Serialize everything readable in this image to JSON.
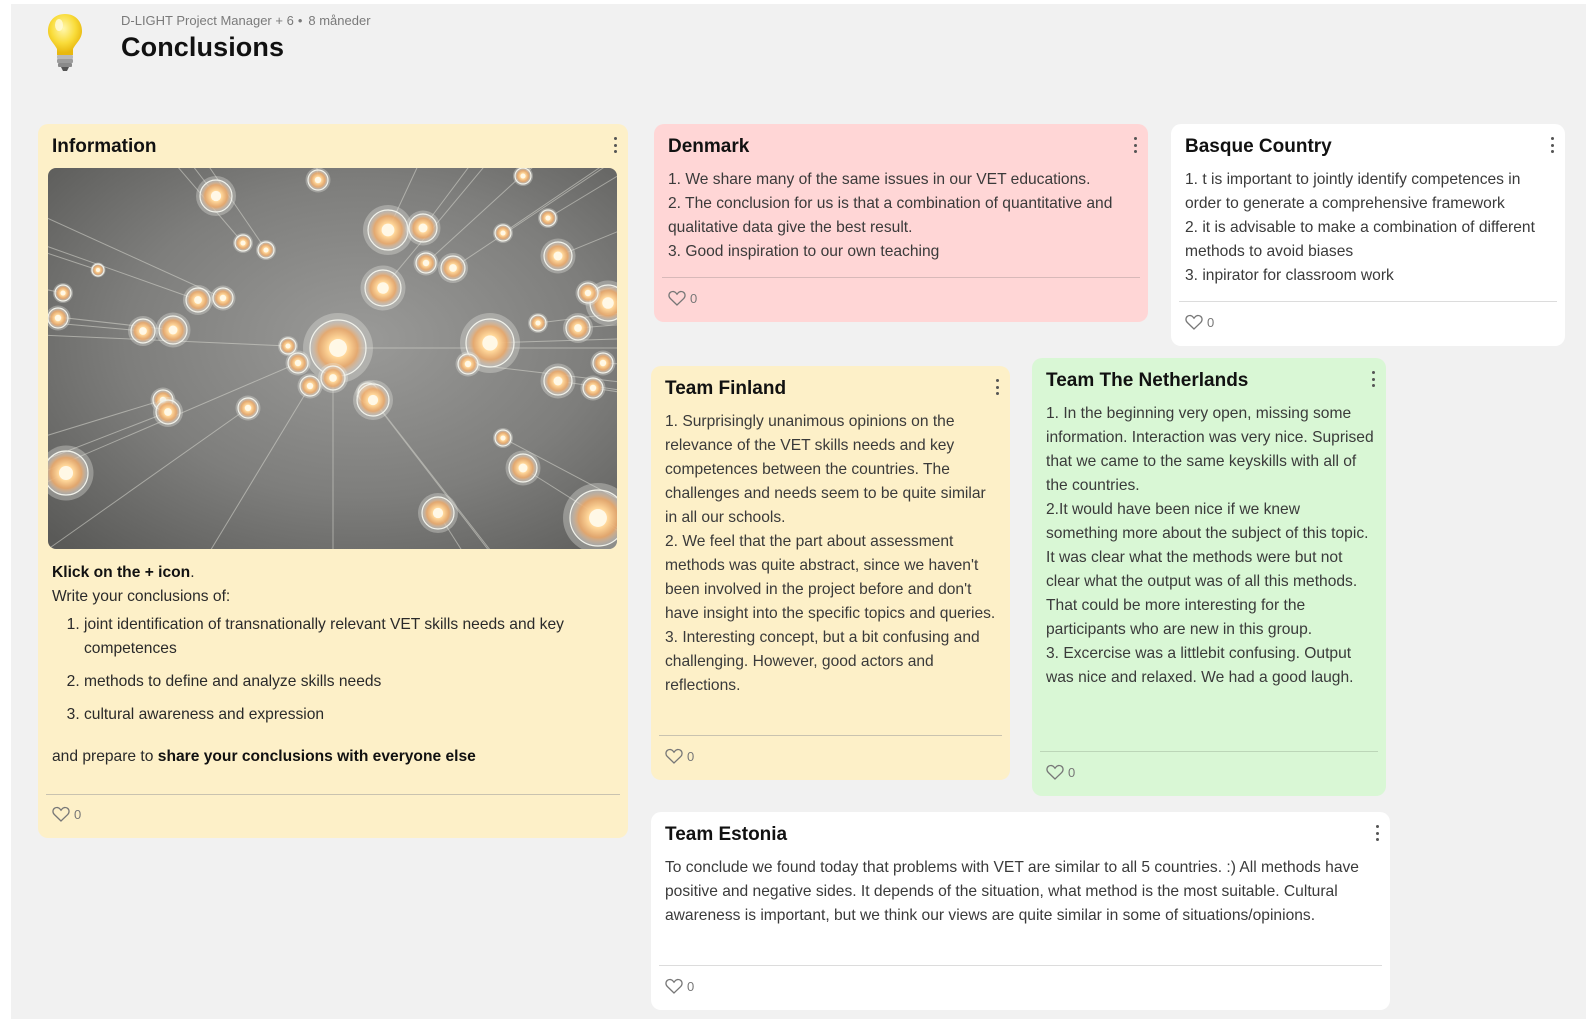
{
  "header": {
    "meta_author": "D-LIGHT Project Manager + 6",
    "meta_time": "8 måneder",
    "title": "Conclusions"
  },
  "colors": {
    "yellow_card": "#fdf0c8",
    "pink_card": "#ffd6d6",
    "green_card": "#d9f7d5",
    "white_card": "#ffffff",
    "board_bg": "#f1f1f1"
  },
  "cards": {
    "information": {
      "title": "Information",
      "klick_bold": "Klick on the + icon",
      "klick_rest": ".",
      "write": "Write your conclusions of:",
      "items": [
        "joint identification of transnationally relevant VET skills needs and key competences",
        "methods to define and analyze skills needs",
        "cultural awareness and expression"
      ],
      "share_prefix": "and prepare to ",
      "share_bold": "share your conclusions with everyone else",
      "likes": "0"
    },
    "denmark": {
      "title": "Denmark",
      "lines": [
        "1. We share many of the same issues in our VET educations.",
        "2. The conclusion for us is that a combination of quantitative and qualitative data give the best result.",
        "3. Good inspiration to our own teaching"
      ],
      "likes": "0"
    },
    "basque": {
      "title": "Basque Country",
      "lines": [
        "1. t is important to jointly identify competences in order to generate a comprehensive framework",
        "2. it is advisable to make a combination of different methods to avoid biases",
        "3. inpirator for classroom work"
      ],
      "likes": "0"
    },
    "finland": {
      "title": "Team Finland",
      "lines": [
        "1. Surprisingly unanimous opinions on the relevance of the VET skills needs and key competences between the countries. The challenges and needs seem to be quite similar in all our schools.",
        "2. We feel that the part about assessment methods was quite abstract, since we haven't been involved in the project before and don't have insight into the specific topics and queries.",
        "3. Interesting concept, but a bit confusing and challenging. However, good actors and reflections."
      ],
      "likes": "0"
    },
    "netherlands": {
      "title": "Team The Netherlands",
      "lines": [
        "1. In the beginning very open, missing some information. Interaction was very nice. Suprised that we came to the same keyskills with all of the countries.",
        "2.It would have been nice if we knew something more about the subject of this topic. It was clear what the methods were but not clear what the output was of all this methods. That could be more interesting for the participants who are new in this group.",
        "3. Excercise was a littlebit confusing. Output was nice and relaxed. We had a good laugh."
      ],
      "likes": "0"
    },
    "estonia": {
      "title": "Team Estonia",
      "text": "To conclude we found today that problems with VET are similar to all 5 countries. :) All methods have positive and negative sides. It depends of the situation, what method is the most suitable. Cultural awareness is important, but we think our views are quite similar in some of situations/opinions.",
      "likes": "0"
    }
  }
}
